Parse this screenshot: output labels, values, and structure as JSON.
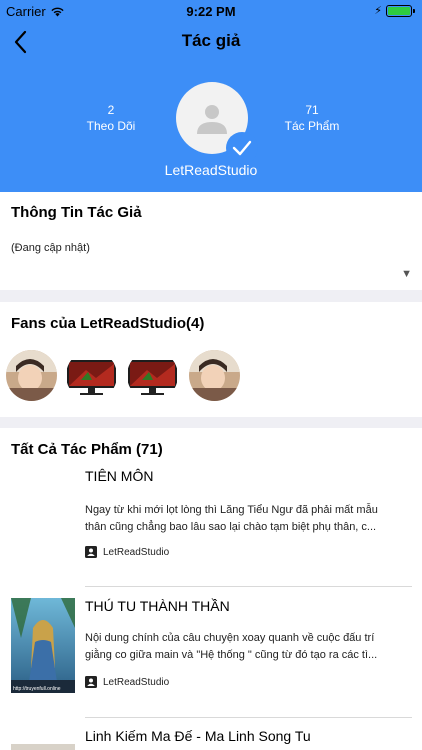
{
  "status_bar": {
    "carrier": "Carrier",
    "time": "9:22 PM"
  },
  "nav": {
    "title": "Tác giả"
  },
  "profile": {
    "name": "LetReadStudio",
    "following_count": "2",
    "following_label": "Theo Dõi",
    "works_count": "71",
    "works_label": "Tác Phẩm"
  },
  "info": {
    "title": "Thông Tin Tác Giả",
    "text": "(Đang cập nhật)"
  },
  "fans": {
    "title": "Fans của LetReadStudio(4)",
    "count": 4
  },
  "works": {
    "title": "Tất Cả Tác Phẩm (71)",
    "books": [
      {
        "title": "TIÊN MÔN",
        "desc_line1": "Ngay từ khi mới lọt lòng thì Lăng Tiểu Ngư đã phải mất mẫu",
        "desc_line2": "thân cũng chẳng bao lâu sao lại chào tạm biệt phụ thân, c...",
        "author": "LetReadStudio"
      },
      {
        "title": "THÚ TU THÀNH THẦN",
        "desc_line1": "Nội dung chính của câu chuyện xoay quanh về cuộc đấu trí",
        "desc_line2": "giằng co giữa main và \"Hệ thống \" cũng từ đó tạo ra các tì...",
        "author": "LetReadStudio",
        "cover_caption": "http://truyenfull.online"
      },
      {
        "title": "Linh Kiếm Ma Đế - Ma Linh Song Tu"
      }
    ]
  },
  "colors": {
    "primary": "#3d8ef7",
    "background": "#efeff4",
    "battery": "#2ecc40"
  },
  "icons": [
    "wifi-icon",
    "back-chevron-icon",
    "user-placeholder-icon",
    "check-icon",
    "dropdown-arrow-icon",
    "author-card-icon"
  ]
}
